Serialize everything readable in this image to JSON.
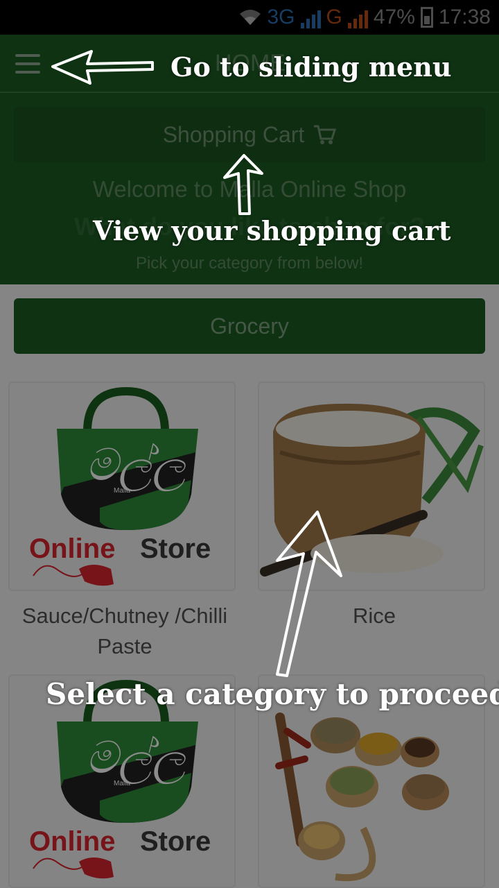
{
  "status_bar": {
    "network_a": "3G",
    "network_b": "G",
    "battery": "47%",
    "time": "17:38"
  },
  "app_bar": {
    "title": "HOME",
    "menu_icon": "hamburger-menu-icon"
  },
  "header": {
    "cart_label": "Shopping Cart",
    "cart_icon": "shopping-cart-icon",
    "welcome": "Welcome to Malla Online Shop",
    "question": "What do you like to shop for?",
    "pick": "Pick your category from below!"
  },
  "section": {
    "label": "Grocery"
  },
  "categories": [
    {
      "name": "Sauce/Chutney /Chilli Paste",
      "image": "malla-online-store-logo"
    },
    {
      "name": "Rice",
      "image": "rice-sack-photo"
    },
    {
      "name": "",
      "image": "malla-online-store-logo"
    },
    {
      "name": "",
      "image": "spices-photo"
    }
  ],
  "logo": {
    "brand_script": "මල්ල",
    "brand_small": "Malla",
    "word_online": "Online",
    "word_store": "Store"
  },
  "tutorial": {
    "menu_tip": "Go to sliding menu",
    "cart_tip": "View your shopping cart",
    "category_tip": "Select a category to proceed"
  },
  "colors": {
    "primary_green": "#1d5c23",
    "accent_red": "#d8262e",
    "overlay_text": "#ffffff"
  }
}
